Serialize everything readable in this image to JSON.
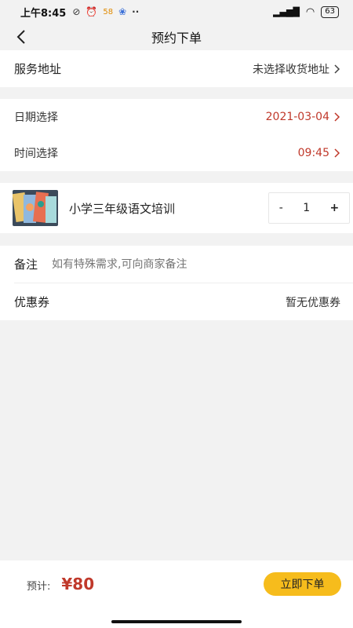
{
  "status_bar": {
    "time": "上午8:45",
    "extra_icons": [
      "58",
      "··"
    ],
    "battery": "63"
  },
  "nav": {
    "title": "预约下单"
  },
  "address": {
    "label": "服务地址",
    "value": "未选择收货地址"
  },
  "schedule": {
    "date_label": "日期选择",
    "date_value": "2021-03-04",
    "time_label": "时间选择",
    "time_value": "09:45"
  },
  "product": {
    "name": "小学三年级语文培训",
    "quantity": "1",
    "minus": "-",
    "plus": "+"
  },
  "remark": {
    "label": "备注",
    "placeholder": "如有特殊需求,可向商家备注"
  },
  "coupon": {
    "label": "优惠券",
    "value": "暂无优惠券"
  },
  "footer": {
    "total_label": "预计:",
    "total_price": "¥80",
    "submit_label": "立即下单"
  },
  "colors": {
    "accent_red": "#c0392b",
    "button_yellow": "#f6bc1c"
  }
}
